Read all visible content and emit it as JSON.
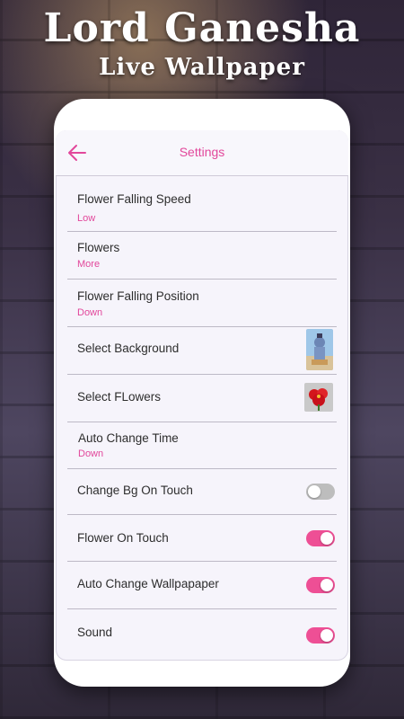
{
  "promo": {
    "title": "Lord Ganesha",
    "subtitle": "Live Wallpaper"
  },
  "appbar": {
    "title": "Settings",
    "back_icon": "arrow-left-icon"
  },
  "colors": {
    "accent": "#e2479b",
    "toggle_on": "#ee4f95",
    "toggle_off": "#bdbdbd"
  },
  "settings": [
    {
      "label": "Flower Falling Speed",
      "value": "Low"
    },
    {
      "label": "Flowers",
      "value": "More"
    },
    {
      "label": "Flower Falling Position",
      "value": "Down"
    },
    {
      "label": "Select Background",
      "thumbnail": "shiva-image-icon"
    },
    {
      "label": "Select FLowers",
      "thumbnail": "red-flower-icon"
    },
    {
      "label": "Auto Change Time",
      "value": "Down"
    },
    {
      "label": "Change Bg On Touch",
      "toggle": false
    },
    {
      "label": "Flower On Touch",
      "toggle": true
    },
    {
      "label": "Auto Change Wallpapaper",
      "toggle": true
    },
    {
      "label": "Sound",
      "toggle": true
    }
  ]
}
